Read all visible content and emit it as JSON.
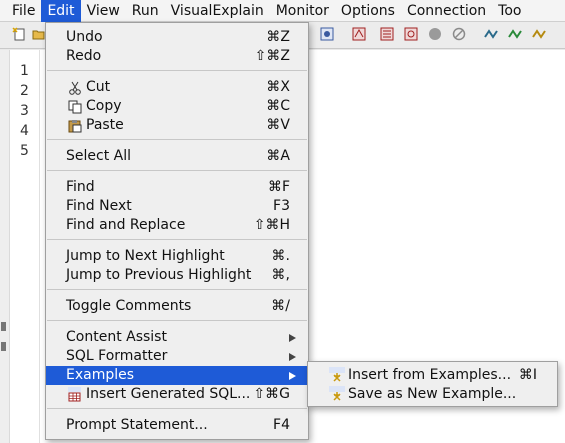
{
  "menubar": {
    "items": [
      "File",
      "Edit",
      "View",
      "Run",
      "VisualExplain",
      "Monitor",
      "Options",
      "Connection",
      "Too"
    ],
    "active_index": 1
  },
  "editor": {
    "line_numbers": [
      "1",
      "2",
      "3",
      "4",
      "5"
    ]
  },
  "edit_menu": {
    "undo": {
      "label": "Undo",
      "shortcut": "⌘Z"
    },
    "redo": {
      "label": "Redo",
      "shortcut": "⇧⌘Z"
    },
    "cut": {
      "label": "Cut",
      "shortcut": "⌘X"
    },
    "copy": {
      "label": "Copy",
      "shortcut": "⌘C"
    },
    "paste": {
      "label": "Paste",
      "shortcut": "⌘V"
    },
    "select_all": {
      "label": "Select All",
      "shortcut": "⌘A"
    },
    "find": {
      "label": "Find",
      "shortcut": "⌘F"
    },
    "find_next": {
      "label": "Find Next",
      "shortcut": "F3"
    },
    "find_replace": {
      "label": "Find and Replace",
      "shortcut": "⇧⌘H"
    },
    "jump_next": {
      "label": "Jump to Next Highlight",
      "shortcut": "⌘."
    },
    "jump_prev": {
      "label": "Jump to Previous Highlight",
      "shortcut": "⌘,"
    },
    "toggle_comments": {
      "label": "Toggle Comments",
      "shortcut": "⌘/"
    },
    "content_assist": {
      "label": "Content Assist"
    },
    "sql_formatter": {
      "label": "SQL Formatter"
    },
    "examples": {
      "label": "Examples"
    },
    "insert_generated_sql": {
      "label": "Insert Generated SQL...",
      "shortcut": "⇧⌘G"
    },
    "prompt_statement": {
      "label": "Prompt Statement...",
      "shortcut": "F4"
    }
  },
  "examples_submenu": {
    "insert": {
      "label": "Insert from Examples...",
      "shortcut": "⌘I"
    },
    "save": {
      "label": "Save as New Example..."
    }
  },
  "colors": {
    "highlight": "#1e5bd7",
    "menu_bg": "#efefef"
  }
}
